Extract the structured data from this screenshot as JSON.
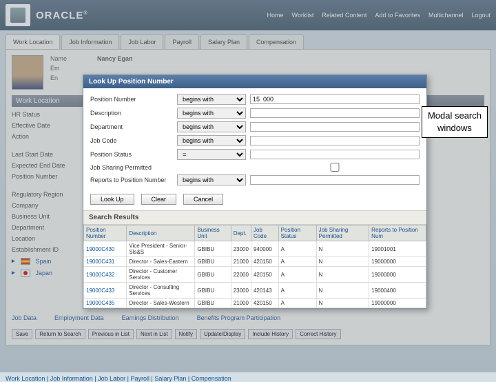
{
  "brand": "ORACLE",
  "topnav": [
    "Home",
    "Worklist",
    "Related Content",
    "Add to Favorites",
    "Multichannel",
    "Logout"
  ],
  "tabs": [
    "Work Location",
    "Job Information",
    "Job Labor",
    "Payroll",
    "Salary Plan",
    "Compensation"
  ],
  "employee": {
    "name_lbl": "Name",
    "name_val": "Nancy Egan",
    "em_lbl": "Em",
    "en_lbl": "En"
  },
  "section1_title": "Work Location",
  "left_fields": [
    "HR Status",
    "Effective Date",
    "Action",
    "Last Start Date",
    "Expected End Date",
    "Position Number",
    "Regulatory Region",
    "Company",
    "Business Unit",
    "Department",
    "Location",
    "Establishment ID"
  ],
  "countries": {
    "spain": "Spain",
    "japan": "Japan"
  },
  "bottom_links": [
    "Job Data",
    "Employment Data",
    "Earnings Distribution",
    "Benefits Program Participation"
  ],
  "bottom_buttons": [
    "Save",
    "Return to Search",
    "Previous in List",
    "Next in List",
    "Notify",
    "Update/Display",
    "Include History",
    "Correct History"
  ],
  "breadcrumb": [
    "Work Location",
    "Job Information",
    "Job Labor",
    "Payroll",
    "Salary Plan",
    "Compensation"
  ],
  "modal": {
    "title": "Look Up Position Number",
    "rows": [
      {
        "label": "Position Number",
        "op": "begins with",
        "val": "15  000"
      },
      {
        "label": "Description",
        "op": "begins with",
        "val": ""
      },
      {
        "label": "Department",
        "op": "begins with",
        "val": ""
      },
      {
        "label": "Job Code",
        "op": "begins with",
        "val": ""
      },
      {
        "label": "Position Status",
        "op": "=",
        "val": ""
      },
      {
        "label": "Job Sharing Permitted",
        "op": "",
        "val": ""
      },
      {
        "label": "Reports to Position Number",
        "op": "begins with",
        "val": ""
      }
    ],
    "buttons": {
      "lookup": "Look Up",
      "clear": "Clear",
      "cancel": "Cancel"
    },
    "results_title": "Search Results",
    "columns": [
      "Position Number",
      "Description",
      "Business Unit",
      "Dept.",
      "Job Code",
      "Position Status",
      "Job Sharing Permitted",
      "Reports to Position Num"
    ],
    "data": [
      [
        "19000C430",
        "Vice President - Senior-Sls&S",
        "GBIBU",
        "23000",
        "940000",
        "A",
        "N",
        "19001001"
      ],
      [
        "19000C431",
        "Director - Sales-Eastern",
        "GBIBU",
        "21000",
        "420150",
        "A",
        "N",
        "19000000"
      ],
      [
        "19000C432",
        "Director - Customer Services",
        "GBIBU",
        "22000",
        "420150",
        "A",
        "N",
        "19000000"
      ],
      [
        "19000C433",
        "Director - Consulting Services",
        "GBIBU",
        "23000",
        "420143",
        "A",
        "N",
        "19000400"
      ],
      [
        "19000C435",
        "Director - Sales-Western",
        "GBIBU",
        "21000",
        "420150",
        "A",
        "N",
        "19000000"
      ]
    ]
  },
  "callout": {
    "l1": "Modal search",
    "l2": "windows"
  }
}
